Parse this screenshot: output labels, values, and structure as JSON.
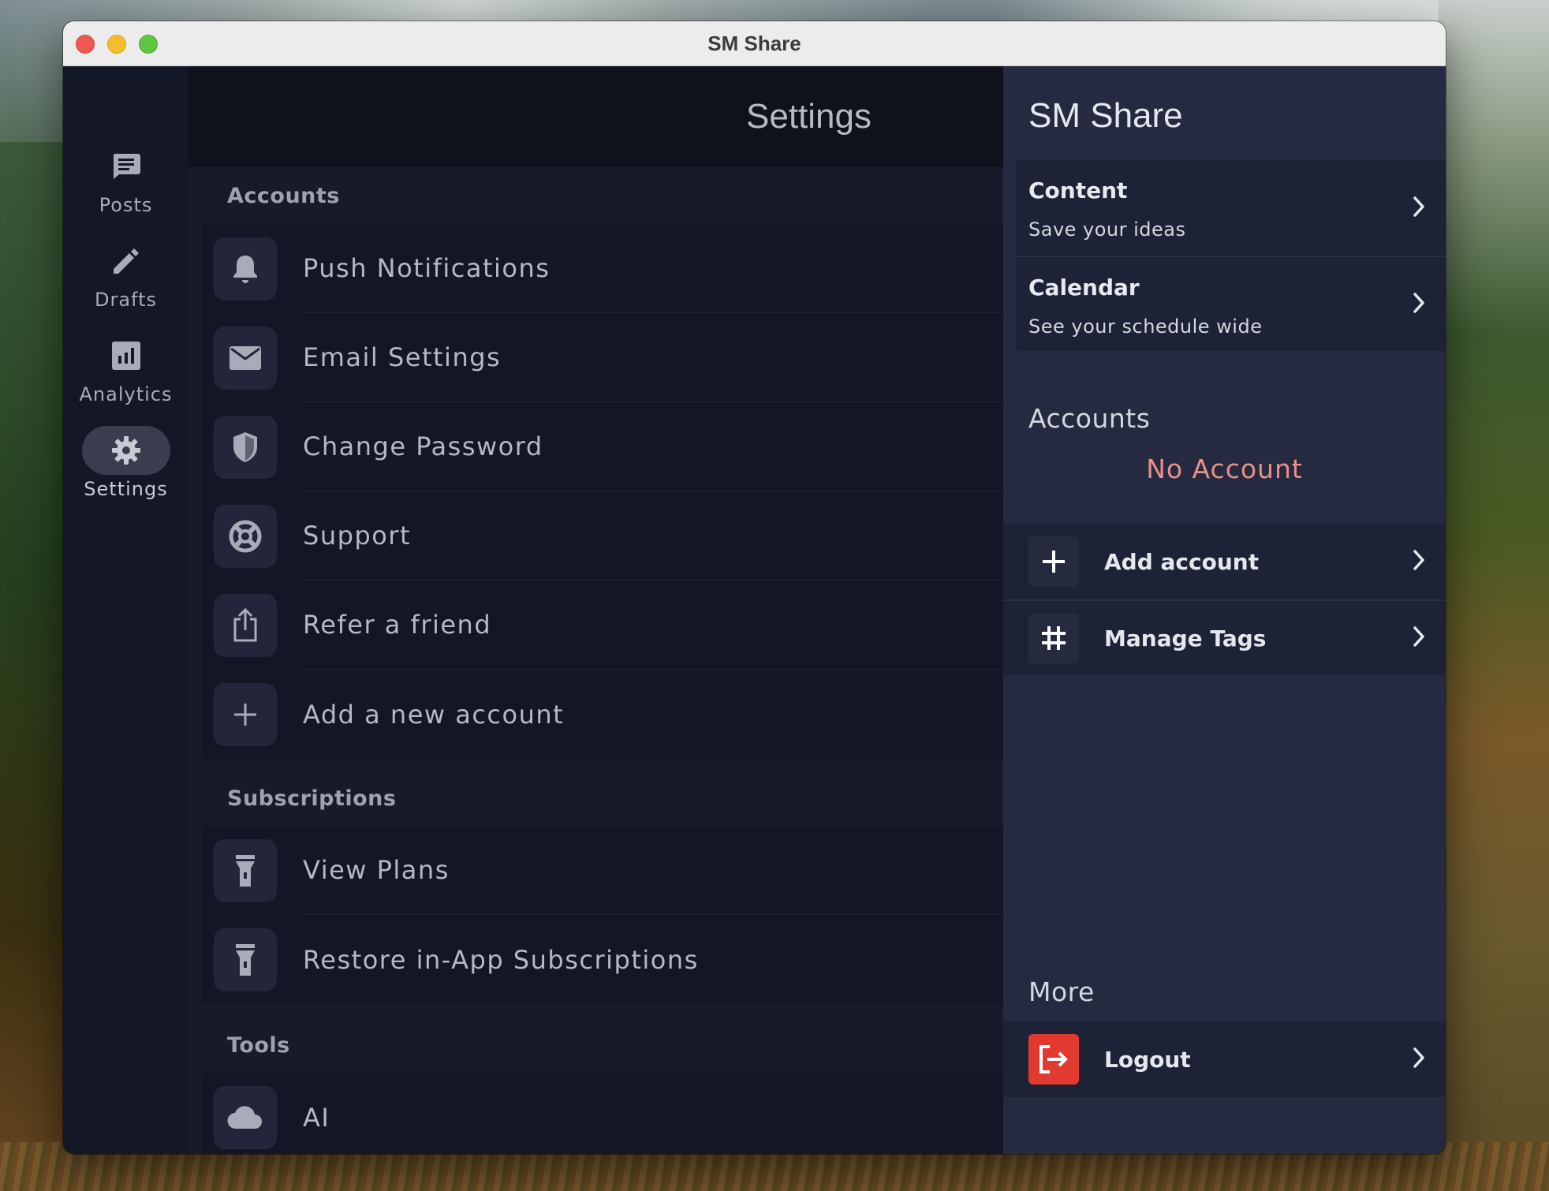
{
  "window": {
    "title": "SM Share"
  },
  "sidebar": {
    "items": [
      {
        "label": "Posts",
        "icon": "posts-icon",
        "active": false
      },
      {
        "label": "Drafts",
        "icon": "pencil-icon",
        "active": false
      },
      {
        "label": "Analytics",
        "icon": "analytics-icon",
        "active": false
      },
      {
        "label": "Settings",
        "icon": "gear-icon",
        "active": true
      }
    ]
  },
  "main": {
    "title": "Settings",
    "sections": {
      "accounts": {
        "title": "Accounts",
        "items": [
          {
            "label": "Push Notifications",
            "icon": "bell-icon"
          },
          {
            "label": "Email Settings",
            "icon": "envelope-icon"
          },
          {
            "label": "Change Password",
            "icon": "shield-icon"
          },
          {
            "label": "Support",
            "icon": "lifebuoy-icon"
          },
          {
            "label": "Refer a friend",
            "icon": "share-icon"
          },
          {
            "label": "Add a new account",
            "icon": "plus-icon"
          }
        ]
      },
      "subscriptions": {
        "title": "Subscriptions",
        "items": [
          {
            "label": "View Plans",
            "icon": "flashlight-icon"
          },
          {
            "label": "Restore in-App Subscriptions",
            "icon": "flashlight-icon"
          }
        ]
      },
      "tools": {
        "title": "Tools",
        "items": [
          {
            "label": "AI",
            "icon": "cloud-icon"
          }
        ]
      }
    }
  },
  "panel": {
    "title": "SM Share",
    "nav": [
      {
        "title": "Content",
        "subtitle": "Save your ideas"
      },
      {
        "title": "Calendar",
        "subtitle": "See your schedule wide"
      }
    ],
    "accounts": {
      "title": "Accounts",
      "empty_text": "No Account",
      "empty_color": "#e8908a",
      "actions": [
        {
          "label": "Add account",
          "icon": "plus-icon"
        },
        {
          "label": "Manage Tags",
          "icon": "hashtag-icon"
        }
      ]
    },
    "more": {
      "title": "More",
      "actions": [
        {
          "label": "Logout",
          "icon": "logout-icon",
          "color": "#e23a2f"
        }
      ]
    }
  }
}
